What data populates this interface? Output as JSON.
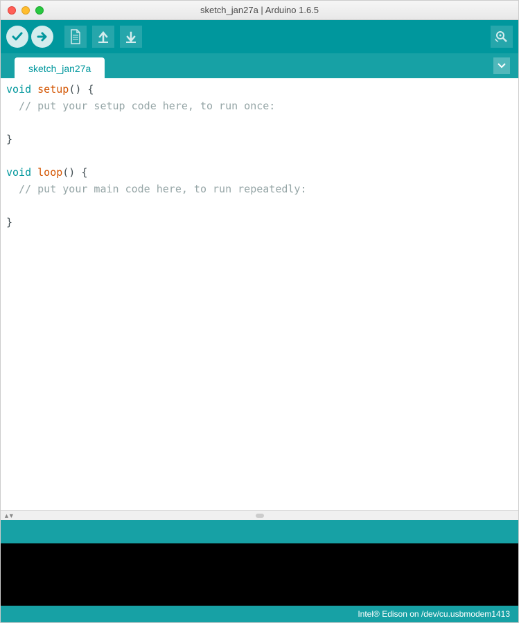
{
  "window": {
    "title": "sketch_jan27a | Arduino 1.6.5"
  },
  "tabs": {
    "active": "sketch_jan27a"
  },
  "editor": {
    "lines": [
      {
        "segments": [
          {
            "text": "void",
            "class": "kw-type"
          },
          {
            "text": " "
          },
          {
            "text": "setup",
            "class": "kw-func"
          },
          {
            "text": "() {"
          }
        ]
      },
      {
        "segments": [
          {
            "text": "  "
          },
          {
            "text": "// put your setup code here, to run once:",
            "class": "comment"
          }
        ]
      },
      {
        "segments": [
          {
            "text": ""
          }
        ]
      },
      {
        "segments": [
          {
            "text": "}"
          }
        ]
      },
      {
        "segments": [
          {
            "text": ""
          }
        ]
      },
      {
        "segments": [
          {
            "text": "void",
            "class": "kw-type"
          },
          {
            "text": " "
          },
          {
            "text": "loop",
            "class": "kw-func"
          },
          {
            "text": "() {"
          }
        ]
      },
      {
        "segments": [
          {
            "text": "  "
          },
          {
            "text": "// put your main code here, to run repeatedly:",
            "class": "comment"
          }
        ]
      },
      {
        "segments": [
          {
            "text": ""
          }
        ]
      },
      {
        "segments": [
          {
            "text": "}"
          }
        ]
      }
    ]
  },
  "footer": {
    "board_info": "Intel® Edison on /dev/cu.usbmodem1413"
  },
  "colors": {
    "teal_primary": "#00979d",
    "teal_secondary": "#17a1a5"
  }
}
